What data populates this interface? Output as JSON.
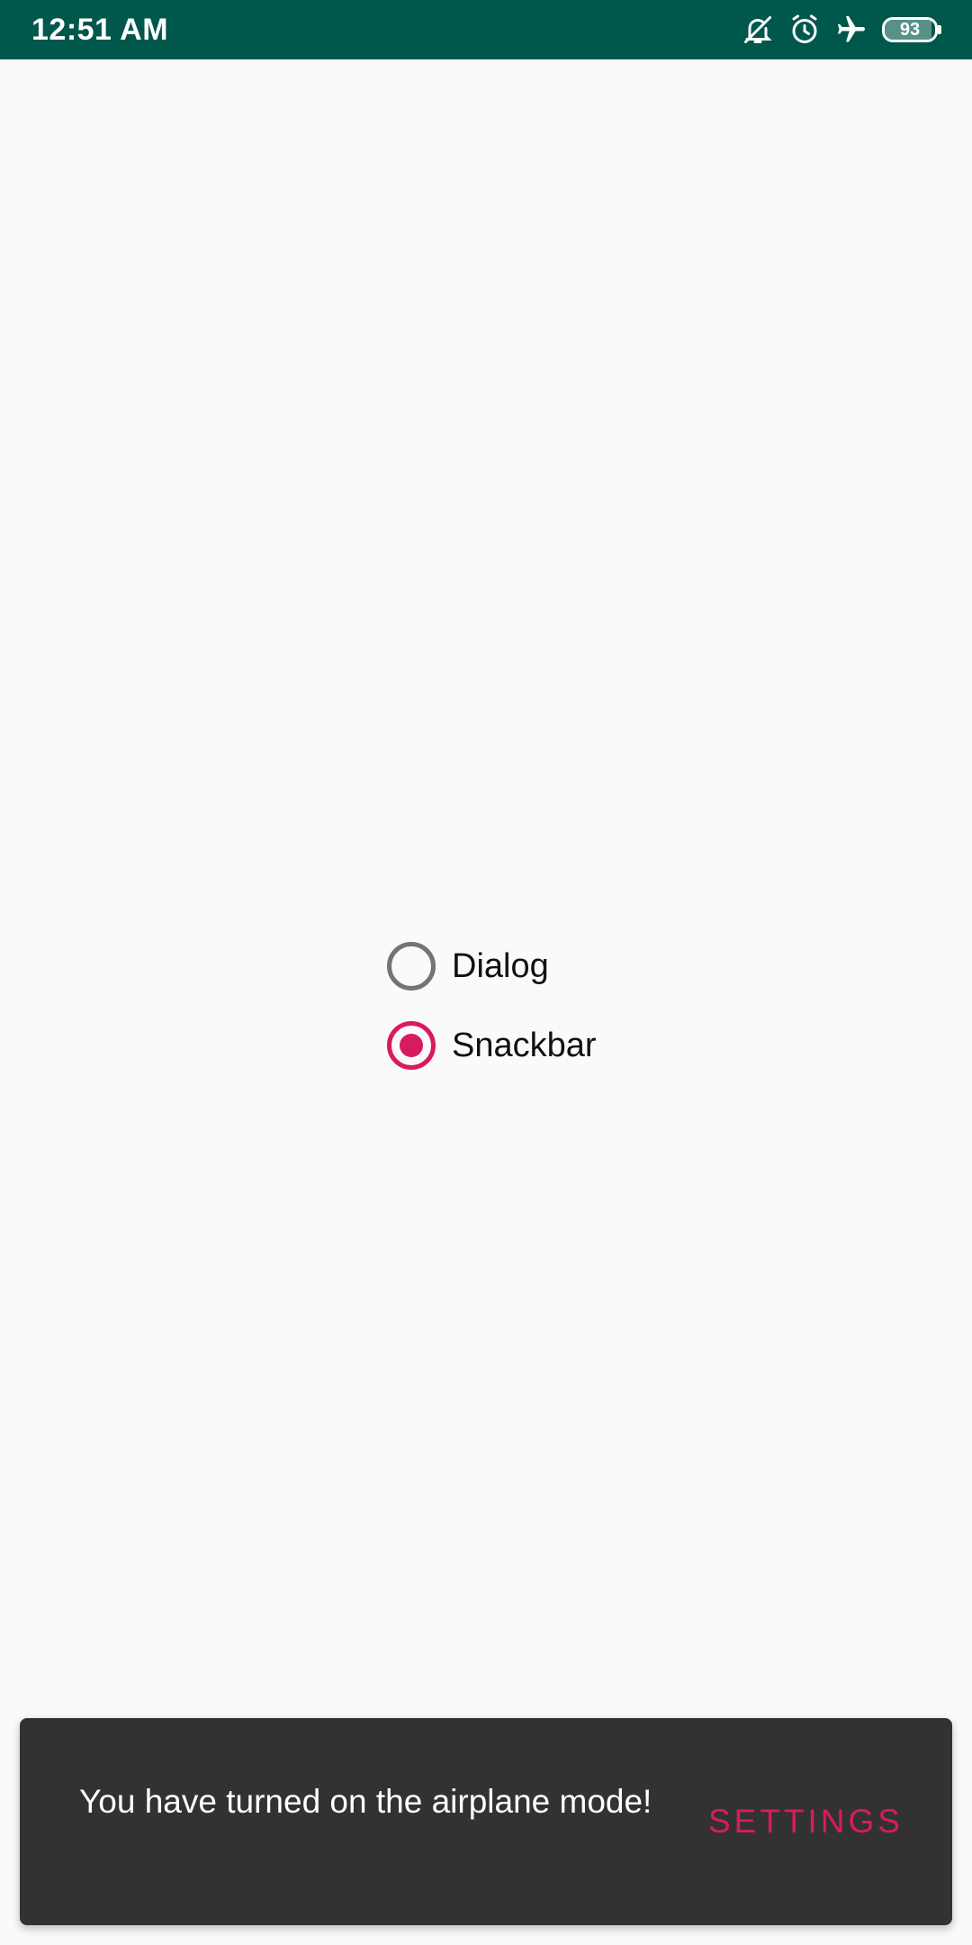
{
  "status_bar": {
    "time": "12:51 AM",
    "icons": [
      "mute-icon",
      "alarm-icon",
      "airplane-icon"
    ],
    "battery_level": "93",
    "background_color": "#00574b"
  },
  "radio_group": {
    "options": [
      {
        "label": "Dialog",
        "checked": false
      },
      {
        "label": "Snackbar",
        "checked": true
      }
    ],
    "accent_color": "#d81b60"
  },
  "snackbar": {
    "message": "You have turned on the airplane mode!",
    "action_label": "SETTINGS",
    "background_color": "#323232",
    "action_color": "#d81b60"
  }
}
